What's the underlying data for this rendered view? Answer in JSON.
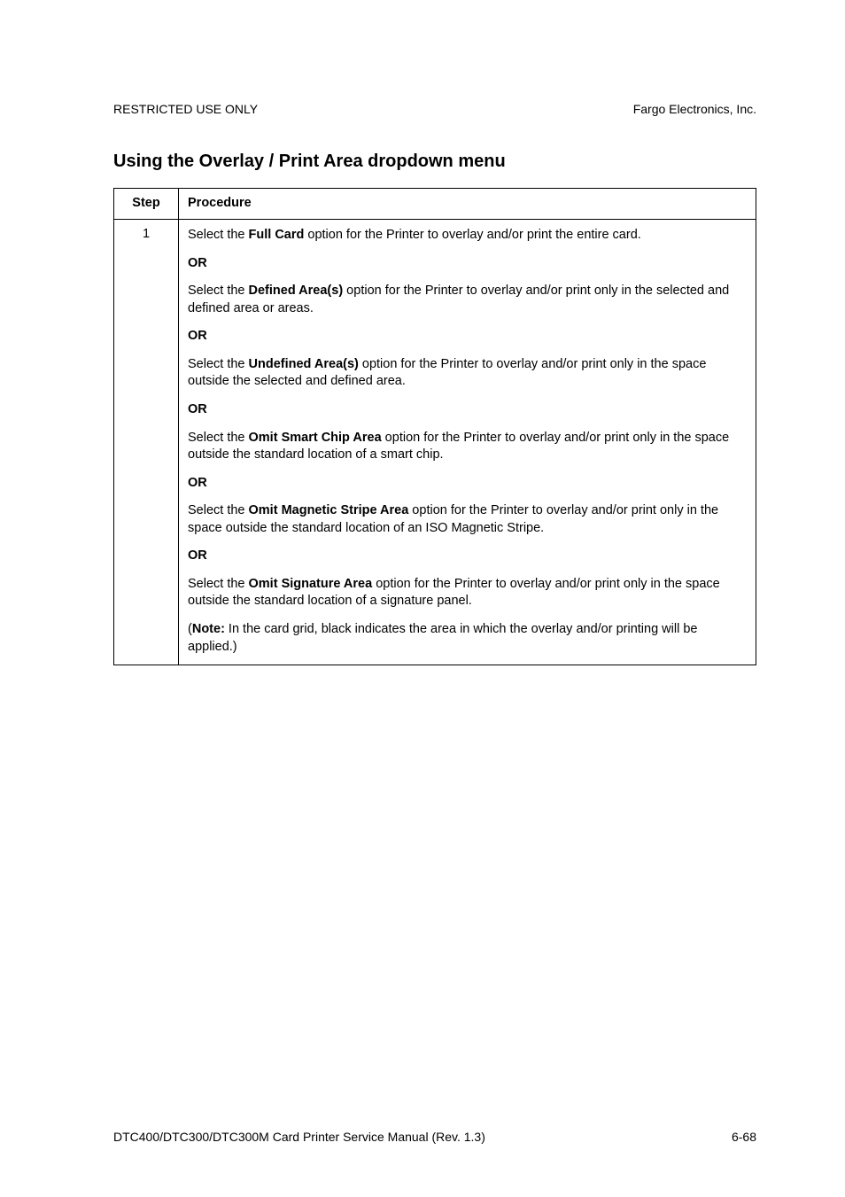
{
  "header": {
    "left": "RESTRICTED USE ONLY",
    "right": "Fargo Electronics, Inc."
  },
  "title": "Using the Overlay / Print Area dropdown menu",
  "table": {
    "head_step": "Step",
    "head_procedure": "Procedure",
    "step_number": "1",
    "p1_a": "Select the ",
    "p1_b": "Full Card",
    "p1_c": " option for the Printer to overlay and/or print the entire card.",
    "or": "OR",
    "p2_a": "Select the ",
    "p2_b": "Defined Area(s)",
    "p2_c": " option for the Printer to overlay and/or print only in the selected and defined area or areas.",
    "p3_a": "Select the ",
    "p3_b": "Undefined Area(s)",
    "p3_c": " option for the Printer to overlay and/or print only in the space outside the selected and defined area.",
    "p4_a": "Select the ",
    "p4_b": "Omit Smart Chip Area",
    "p4_c": " option for the Printer to overlay and/or print only in the space outside the standard location of a smart chip.",
    "p5_a": "Select the ",
    "p5_b": "Omit Magnetic Stripe Area",
    "p5_c": " option for the Printer to overlay and/or print only in the space outside the standard location of an ISO Magnetic Stripe.",
    "p6_a": "Select the ",
    "p6_b": "Omit Signature Area",
    "p6_c": " option for the Printer to overlay and/or print only in the space outside the standard location of a signature panel.",
    "note_a": "(",
    "note_b": "Note:",
    "note_c": " In the card grid, black indicates the area in which the overlay and/or printing will be applied.)"
  },
  "footer": {
    "left": "DTC400/DTC300/DTC300M Card Printer Service Manual (Rev. 1.3)",
    "right": "6-68"
  }
}
